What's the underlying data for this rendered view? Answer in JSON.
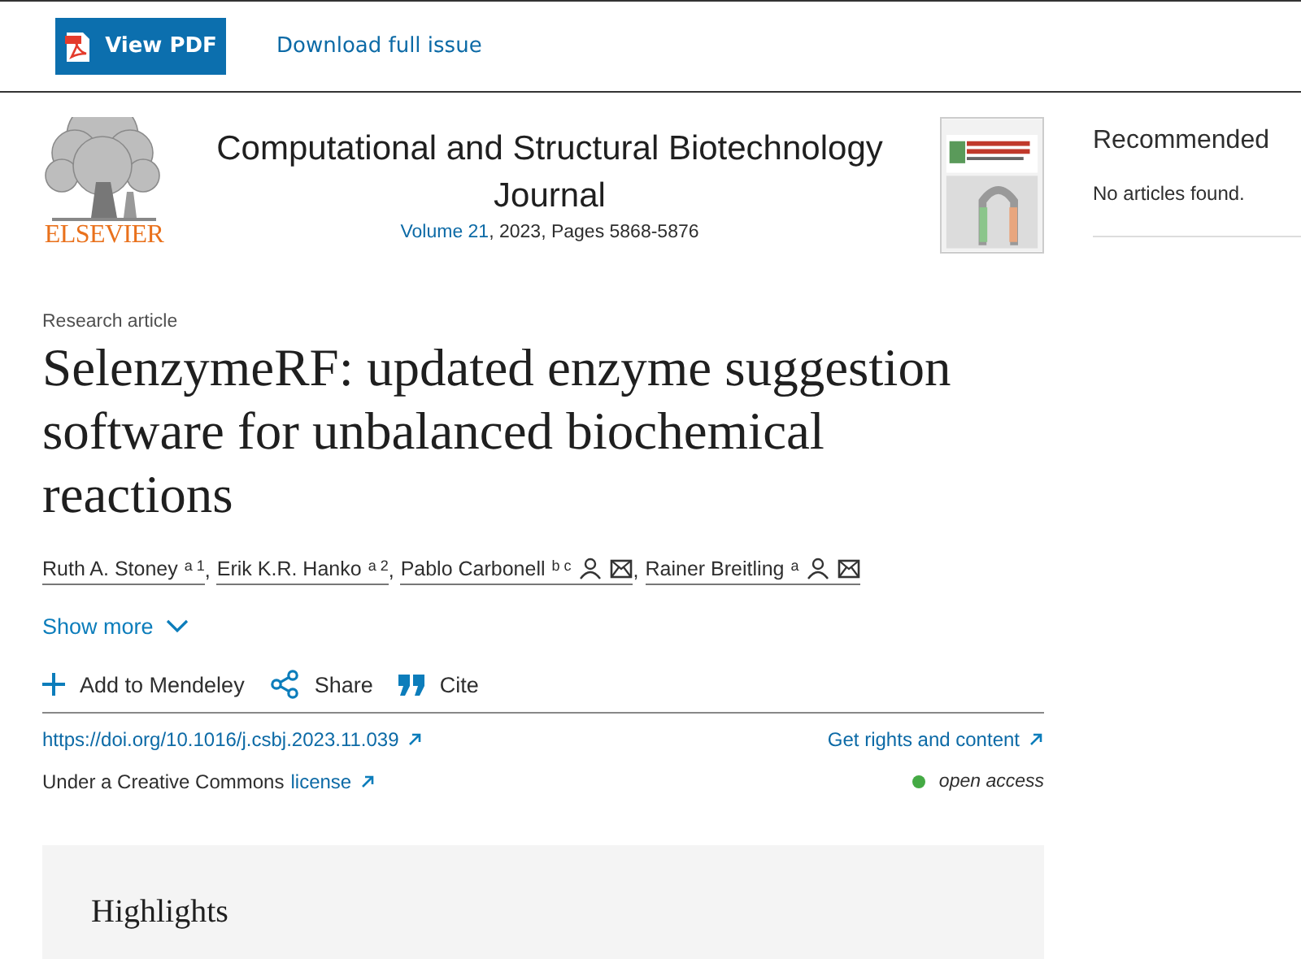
{
  "toolbar": {
    "pdf_button": "View PDF",
    "download_link": "Download full issue"
  },
  "journal": {
    "publisher": "ELSEVIER",
    "title": "Computational and Structural Biotechnology Journal",
    "volume_link": "Volume 21",
    "details": ", 2023, Pages 5868-5876"
  },
  "article": {
    "type": "Research article",
    "title": "SelenzymeRF: updated enzyme suggestion software for unbalanced biochemical reactions",
    "authors": [
      {
        "name": "Ruth A. Stoney",
        "sup": "a 1",
        "contact": false,
        "separator": ","
      },
      {
        "name": "Erik K.R. Hanko",
        "sup": "a 2",
        "contact": false,
        "separator": ","
      },
      {
        "name": "Pablo Carbonell",
        "sup": "b c",
        "contact": true,
        "separator": ","
      },
      {
        "name": "Rainer Breitling",
        "sup": "a",
        "contact": true
      }
    ],
    "show_more": "Show more",
    "actions": [
      {
        "kind": "add",
        "label": "Add to Mendeley"
      },
      {
        "kind": "share",
        "label": "Share"
      },
      {
        "kind": "cite",
        "label": "Cite"
      }
    ],
    "doi": "https://doi.org/10.1016/j.csbj.2023.11.039",
    "rights_link": "Get rights and content",
    "license_text": "Under a Creative Commons",
    "license_link": "license",
    "access": {
      "label": "open access",
      "color": "#44aa44"
    }
  },
  "highlights": {
    "heading": "Highlights"
  },
  "sidebar": {
    "heading": "Recommended",
    "message": "No articles found."
  }
}
